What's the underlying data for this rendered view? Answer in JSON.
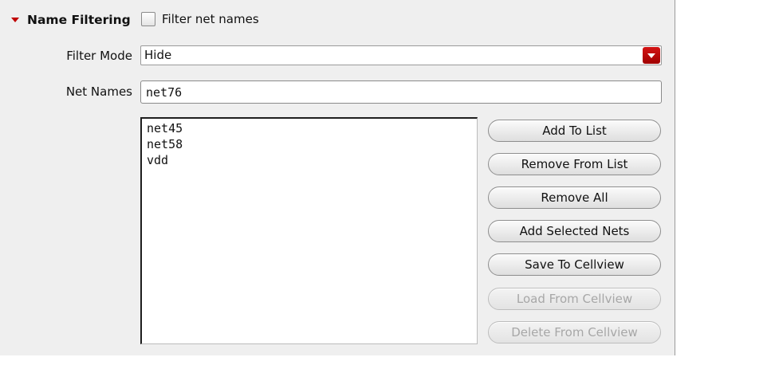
{
  "section": {
    "title": "Name Filtering",
    "filter_checkbox_label": "Filter net names",
    "filter_checkbox_checked": false
  },
  "filter_mode": {
    "label": "Filter Mode",
    "value": "Hide"
  },
  "net_names": {
    "label": "Net Names",
    "value": "net76"
  },
  "net_list": [
    "net45",
    "net58",
    "vdd"
  ],
  "buttons": {
    "add_to_list": "Add To List",
    "remove_from_list": "Remove From List",
    "remove_all": "Remove All",
    "add_selected_nets": "Add Selected Nets",
    "save_to_cellview": "Save To Cellview",
    "load_from_cellview": "Load From Cellview",
    "delete_from_cellview": "Delete From Cellview"
  },
  "colors": {
    "accent": "#c00000",
    "panel_bg": "#efefef",
    "disabled_text": "#a7a7a7"
  }
}
